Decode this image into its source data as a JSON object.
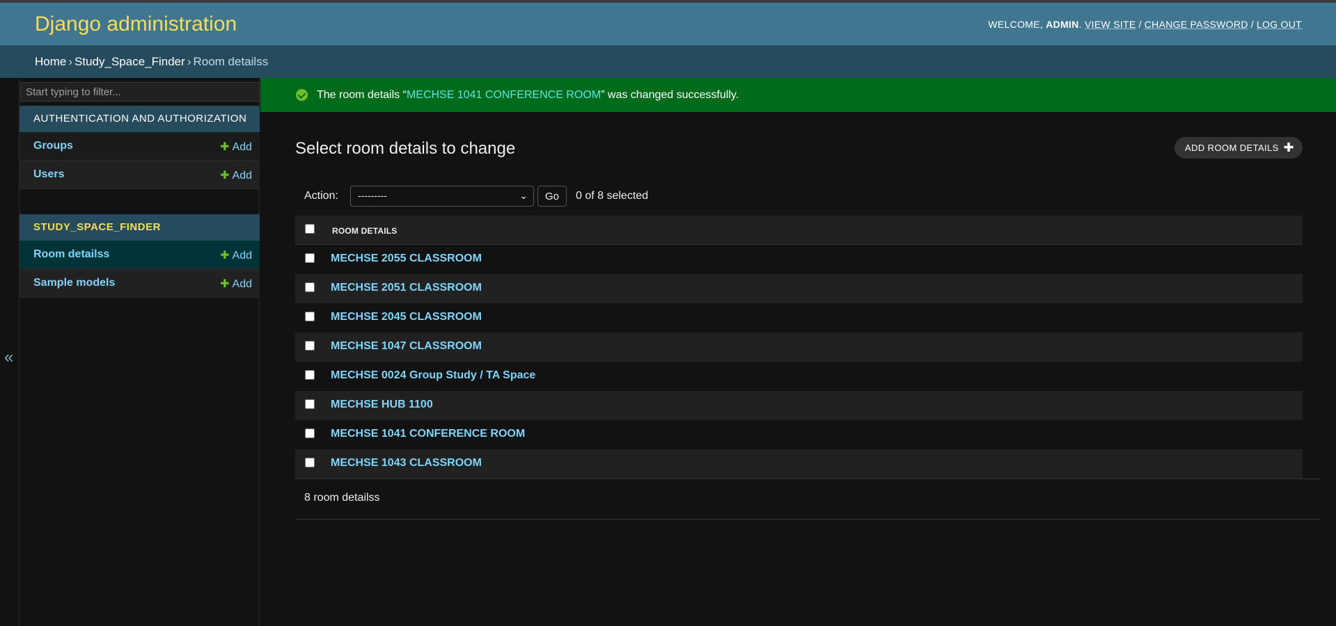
{
  "header": {
    "brand": "Django administration",
    "welcome": "WELCOME,",
    "username": "ADMIN",
    "view_site": "VIEW SITE",
    "change_password": "CHANGE PASSWORD",
    "log_out": "LOG OUT"
  },
  "breadcrumbs": {
    "home": "Home",
    "app": "Study_Space_Finder",
    "current": "Room detailss"
  },
  "sidebar": {
    "toggle": "«",
    "filter_placeholder": "Start typing to filter...",
    "modules": [
      {
        "caption": "AUTHENTICATION AND AUTHORIZATION",
        "rows": [
          {
            "name": "Groups",
            "add": "Add"
          },
          {
            "name": "Users",
            "add": "Add"
          }
        ]
      },
      {
        "caption": "STUDY_SPACE_FINDER",
        "rows": [
          {
            "name": "Room detailss",
            "add": "Add"
          },
          {
            "name": "Sample models",
            "add": "Add"
          }
        ]
      }
    ]
  },
  "messages": {
    "prefix": "The room details “",
    "object": "MECHSE 1041 CONFERENCE ROOM",
    "suffix": "” was changed successfully."
  },
  "main": {
    "title": "Select room details to change",
    "add_button": "ADD ROOM DETAILS",
    "action_label": "Action:",
    "action_selected": "---------",
    "go": "Go",
    "counter": "0 of 8 selected",
    "column_header": "ROOM DETAILS",
    "rows": [
      "MECHSE 2055 CLASSROOM",
      "MECHSE 2051 CLASSROOM",
      "MECHSE 2045 CLASSROOM",
      "MECHSE 1047 CLASSROOM",
      "MECHSE 0024 Group Study / TA Space",
      "MECHSE HUB 1100",
      "MECHSE 1041 CONFERENCE ROOM",
      "MECHSE 1043 CLASSROOM"
    ],
    "paginator": "8 room detailss"
  },
  "colors": {
    "header_bg": "#417690",
    "breadcrumb_bg": "#264b5d",
    "brand": "#f5dd5d",
    "link": "#81d4fa",
    "success_bg": "#006b1b",
    "add_green": "#70bf2b",
    "selected_row": "#003338"
  }
}
